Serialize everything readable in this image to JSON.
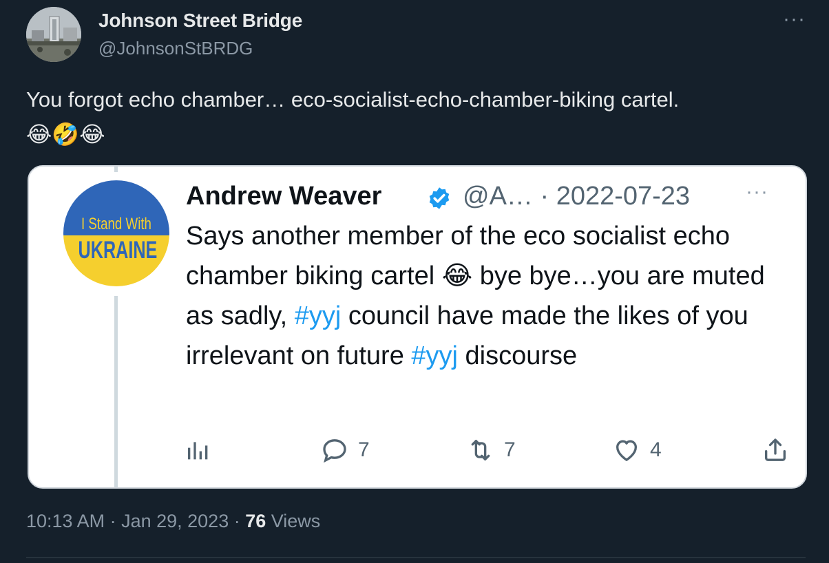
{
  "tweet": {
    "author": {
      "display_name": "Johnson Street Bridge",
      "handle": "@JohnsonStBRDG",
      "avatar_icon": "bridge-photo-avatar"
    },
    "text": "You forgot echo chamber… eco-socialist-echo-chamber-biking cartel.",
    "emojis": [
      "😂",
      "🤣",
      "😂"
    ],
    "timestamp": "10:13 AM · Jan 29, 2023 · ",
    "views_count": "76",
    "views_label": " Views"
  },
  "quoted_tweet": {
    "avatar_text_line1": "I Stand With",
    "avatar_text_line2": "UKRAINE",
    "display_name": "Andrew Weaver",
    "verified_icon": "verified-badge-icon",
    "handle_date": "@A… · 2022-07-23",
    "text_part1": "Says another member of the eco socialist echo chamber biking cartel ",
    "text_emoji": "😂",
    "text_part2": " bye bye…you are muted as sadly, ",
    "hashtag1": "#yyj",
    "text_part3": " council have made the likes of you irrelevant on future ",
    "hashtag2": "#yyj",
    "text_part4": " discourse",
    "actions": {
      "replies": "7",
      "retweets": "7",
      "likes": "4"
    },
    "colors": {
      "hashtag": "#1d9bf0",
      "ukraine_blue": "#2f66b8",
      "ukraine_yellow": "#f5cf2e"
    }
  },
  "more_label": "···"
}
